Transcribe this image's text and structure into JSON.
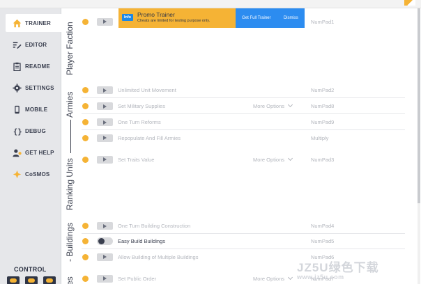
{
  "sidebar": {
    "items": [
      {
        "label": "TRAINER",
        "icon": "home-icon"
      },
      {
        "label": "EDITOR",
        "icon": "edit-icon"
      },
      {
        "label": "README",
        "icon": "clipboard-icon"
      },
      {
        "label": "SETTINGS",
        "icon": "gear-icon"
      },
      {
        "label": "MOBILE",
        "icon": "mobile-icon"
      },
      {
        "label": "DEBUG",
        "icon": "braces-icon"
      },
      {
        "label": "GET HELP",
        "icon": "help-user-icon"
      },
      {
        "label": "CoSMOS",
        "icon": "cosmos-icon"
      }
    ],
    "control_label": "CONTROL"
  },
  "promo": {
    "badge": "Info",
    "title": "Promo Trainer",
    "subtitle": "Cheats are limited for testing purpose only.",
    "get_full": "Get Full Trainer",
    "dismiss": "Dismiss"
  },
  "categories": {
    "player_faction": "Player Faction",
    "armies": "Armies",
    "ranking_units": "Ranking Units",
    "buildings": "- Buildings",
    "res": "es"
  },
  "cheats": [
    {
      "name": "",
      "hotkey": "NumPad1",
      "options": ""
    },
    {
      "name": "Unlimited Unit Movement",
      "hotkey": "NumPad2",
      "options": ""
    },
    {
      "name": "Set Military Supplies",
      "hotkey": "NumPad8",
      "options": "More Options"
    },
    {
      "name": "One Turn Reforms",
      "hotkey": "NumPad9",
      "options": ""
    },
    {
      "name": "Repopulate And Fill Armies",
      "hotkey": "Multiply",
      "options": ""
    },
    {
      "name": "Set Traits Value",
      "hotkey": "NumPad3",
      "options": "More Options"
    },
    {
      "name": "One Turn Building Construction",
      "hotkey": "NumPad4",
      "options": ""
    },
    {
      "name": "Easy Build Buildings",
      "hotkey": "NumPad5",
      "options": ""
    },
    {
      "name": "Allow Building of Multiple Buildings",
      "hotkey": "NumPad6",
      "options": ""
    },
    {
      "name": "Set Public Order",
      "hotkey": "NumPad7",
      "options": "More Options"
    }
  ],
  "watermark": {
    "big": "JZ5U绿色下载",
    "small": "www.jz5u.com"
  },
  "colors": {
    "accent": "#f5b335",
    "promo_blue": "#2c8cf0",
    "sidebar_bg": "#e6e7ea",
    "text_dark": "#3a3f4f"
  }
}
